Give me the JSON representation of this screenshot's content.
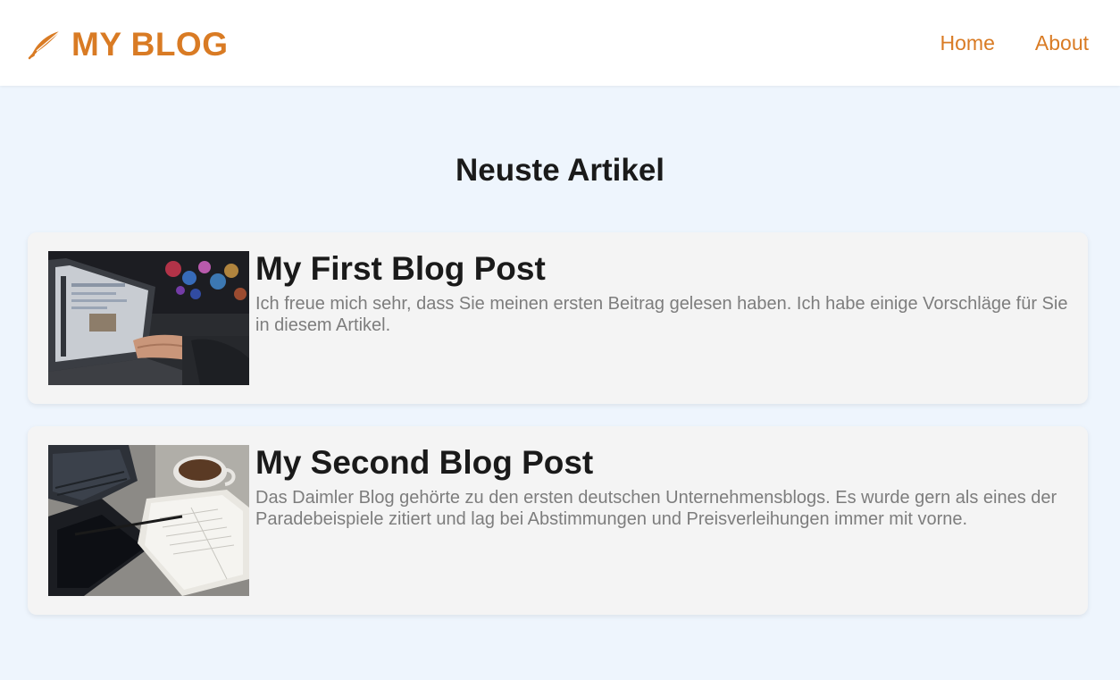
{
  "theme": {
    "accent": "#d97b24",
    "background": "#eef5fd",
    "card_background": "#f4f4f4"
  },
  "header": {
    "logo_icon": "feather-pen-icon",
    "title": "MY BLOG",
    "nav": [
      {
        "label": "Home"
      },
      {
        "label": "About"
      }
    ]
  },
  "main": {
    "section_title": "Neuste Artikel",
    "posts": [
      {
        "title": "My First Blog Post",
        "excerpt": "Ich freue mich sehr, dass Sie meinen ersten Beitrag gelesen haben. Ich habe einige Vorschläge für Sie in diesem Artikel.",
        "image": "laptop-photo"
      },
      {
        "title": "My Second Blog Post",
        "excerpt": "Das Daimler Blog gehörte zu den ersten deutschen Unternehmensblogs. Es wurde gern als eines der Paradebeispiele zitiert und lag bei Abstimmungen und Preisverleihungen immer mit vorne.",
        "image": "notebook-coffee-photo"
      }
    ]
  }
}
